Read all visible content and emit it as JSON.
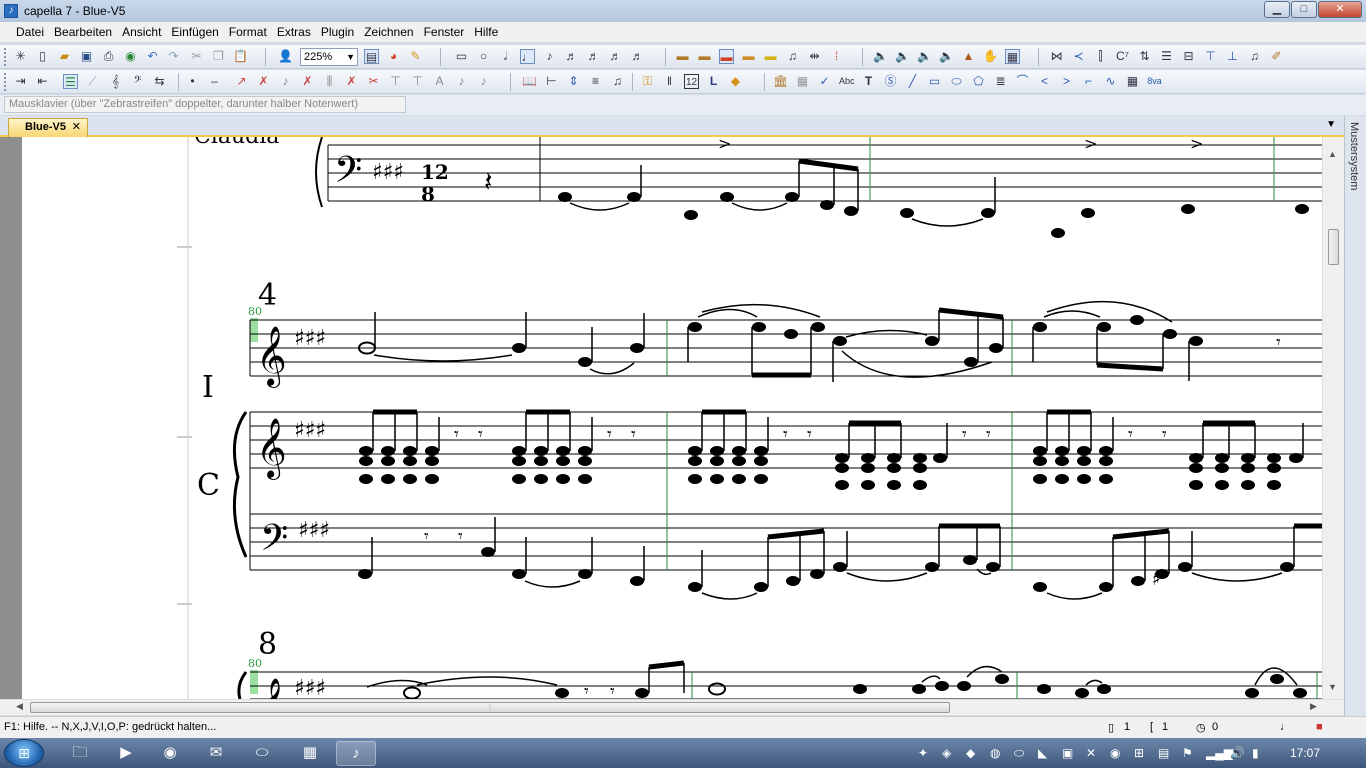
{
  "window": {
    "title": "capella 7 - Blue-V5",
    "min": "▁",
    "max": "□",
    "close": "✕"
  },
  "menu": [
    "Datei",
    "Bearbeiten",
    "Ansicht",
    "Einfügen",
    "Format",
    "Extras",
    "Plugin",
    "Zeichnen",
    "Fenster",
    "Hilfe"
  ],
  "toolbar": {
    "zoom": "225%"
  },
  "hint": "Mausklavier (über \"Zebrastreifen\" doppelter, darunter halber Notenwert)",
  "tab": {
    "label": "Blue-V5",
    "close": "✕"
  },
  "side_panel_label": "Mustersystem",
  "score": {
    "top_text": "Claudia",
    "system2_measure": "4",
    "system3_measure": "8",
    "tempo": "80",
    "tempo_b": "80",
    "instrument_i": "I",
    "instrument_c": "C",
    "time_sig_top": "12",
    "time_sig_bottom": "8"
  },
  "status": {
    "help": "F1: Hilfe. -- N,X,J,V,I,O,P: gedrückt halten...",
    "page": "1",
    "system": "1",
    "zero": "0"
  },
  "taskbar": {
    "clock": "17:07"
  }
}
